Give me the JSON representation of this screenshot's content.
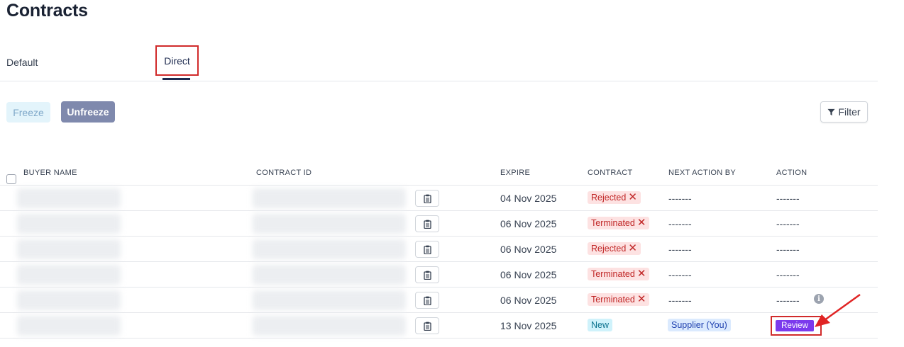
{
  "page": {
    "title": "Contracts"
  },
  "tabs": [
    {
      "label": "Default",
      "active": false
    },
    {
      "label": "Direct",
      "active": true
    }
  ],
  "toolbar": {
    "freeze_label": "Freeze",
    "unfreeze_label": "Unfreeze",
    "filter_label": "Filter"
  },
  "table": {
    "headers": {
      "buyer_name": "BUYER NAME",
      "contract_id": "CONTRACT ID",
      "expire": "EXPIRE",
      "contract": "CONTRACT",
      "next_action_by": "NEXT ACTION BY",
      "action": "ACTION"
    },
    "rows": [
      {
        "expire": "04 Nov 2025",
        "contract": "Rejected",
        "next_action_by": "-------",
        "action": "-------"
      },
      {
        "expire": "06 Nov 2025",
        "contract": "Terminated",
        "next_action_by": "-------",
        "action": "-------"
      },
      {
        "expire": "06 Nov 2025",
        "contract": "Rejected",
        "next_action_by": "-------",
        "action": "-------"
      },
      {
        "expire": "06 Nov 2025",
        "contract": "Terminated",
        "next_action_by": "-------",
        "action": "-------"
      },
      {
        "expire": "06 Nov 2025",
        "contract": "Terminated",
        "next_action_by": "-------",
        "action": "-------"
      },
      {
        "expire": "13 Nov 2025",
        "contract": "New",
        "next_action_by": "Supplier (You)",
        "action": "Review"
      }
    ]
  },
  "info_icon_glyph": "i",
  "close_glyph": "✕",
  "colors": {
    "annotation_red": "#d12b2b",
    "review_purple": "#7c3aed",
    "unfreeze_bg": "#7f89ad"
  }
}
